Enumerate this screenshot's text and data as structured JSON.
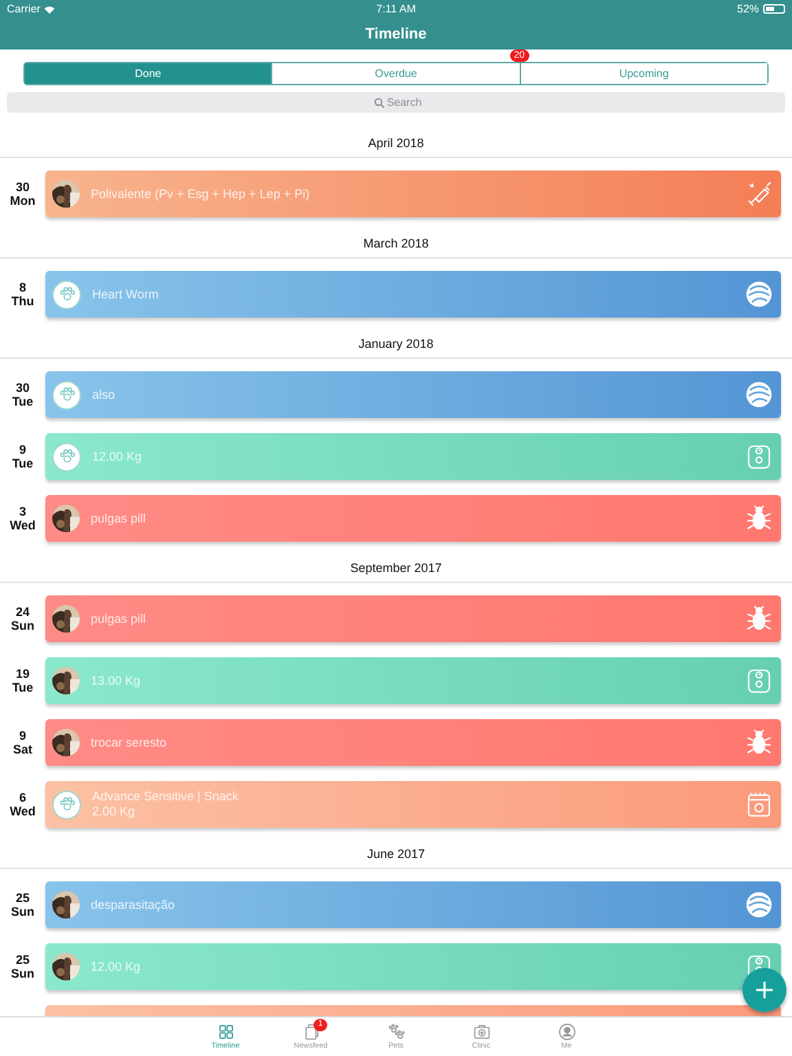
{
  "status_bar": {
    "carrier": "Carrier",
    "time": "7:11 AM",
    "battery": "52%"
  },
  "nav": {
    "title": "Timeline"
  },
  "segments": [
    {
      "label": "Done",
      "selected": true
    },
    {
      "label": "Overdue",
      "selected": false,
      "badge": "20"
    },
    {
      "label": "Upcoming",
      "selected": false
    }
  ],
  "search": {
    "placeholder": "Search"
  },
  "timeline": [
    {
      "month": "April 2018",
      "entries": [
        {
          "day": "30",
          "weekday": "Mon",
          "title": "Polivalente (Pv + Esg + Hep + Lep + Pi)",
          "kind": "vaccine"
        }
      ]
    },
    {
      "month": "March 2018",
      "entries": [
        {
          "day": "8",
          "weekday": "Thu",
          "title": "Heart Worm",
          "kind": "deworm",
          "avatar": {
            "kind": "paw"
          }
        }
      ]
    },
    {
      "month": "January 2018",
      "entries": [
        {
          "day": "30",
          "weekday": "Tue",
          "title": "also",
          "kind": "deworm",
          "avatar": {
            "kind": "paw"
          }
        },
        {
          "day": "9",
          "weekday": "Tue",
          "title": "12.00 Kg",
          "kind": "weight",
          "avatar": {
            "kind": "paw"
          }
        },
        {
          "day": "3",
          "weekday": "Wed",
          "title": "pulgas pill",
          "kind": "flea"
        }
      ]
    },
    {
      "month": "September 2017",
      "entries": [
        {
          "day": "24",
          "weekday": "Sun",
          "title": "pulgas pill",
          "kind": "flea"
        },
        {
          "day": "19",
          "weekday": "Tue",
          "title": "13.00 Kg",
          "kind": "weight"
        },
        {
          "day": "9",
          "weekday": "Sat",
          "title": "trocar seresto",
          "kind": "flea"
        },
        {
          "day": "6",
          "weekday": "Wed",
          "title": "Advance Sensitive | Snack",
          "subtitle": "2.00 Kg",
          "kind": "food",
          "avatar": {
            "kind": "paw"
          }
        }
      ]
    },
    {
      "month": "June 2017",
      "entries": [
        {
          "day": "25",
          "weekday": "Sun",
          "title": "desparasitação",
          "kind": "deworm"
        },
        {
          "day": "25",
          "weekday": "Sun",
          "title": "12.00 Kg",
          "kind": "weight"
        },
        {
          "kind": "food"
        }
      ]
    }
  ],
  "tab_bar": [
    {
      "label": "Timeline",
      "selected": true
    },
    {
      "label": "Newsfeed",
      "selected": false,
      "badge": "1"
    },
    {
      "label": "Pets",
      "selected": false
    },
    {
      "label": "Clinic",
      "selected": false
    },
    {
      "label": "Me",
      "selected": false
    }
  ]
}
